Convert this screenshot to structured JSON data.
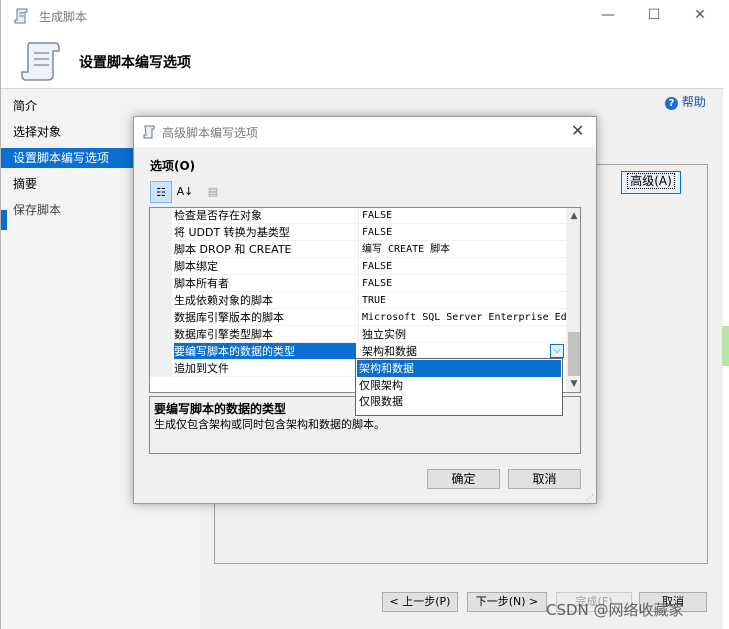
{
  "wizard": {
    "title": "生成脚本",
    "header_title": "设置脚本编写选项",
    "nav": [
      "简介",
      "选择对象",
      "设置脚本编写选项",
      "摘要",
      "保存脚本"
    ],
    "help": "帮助",
    "advanced_btn": "高级(A)",
    "buttons": {
      "prev": "< 上一步(P)",
      "next": "下一步(N) >",
      "finish": "完成(F)",
      "cancel": "取消"
    },
    "watermark": "CSDN @网络收藏家"
  },
  "dialog": {
    "title": "高级脚本编写选项",
    "options_label": "选项(O)",
    "rows": [
      {
        "name": "检查是否存在对象",
        "value": "FALSE"
      },
      {
        "name": "将 UDDT 转换为基类型",
        "value": "FALSE"
      },
      {
        "name": "脚本 DROP 和 CREATE",
        "value": "编写 CREATE 脚本"
      },
      {
        "name": "脚本绑定",
        "value": "FALSE"
      },
      {
        "name": "脚本所有者",
        "value": "FALSE"
      },
      {
        "name": "生成依赖对象的脚本",
        "value": "TRUE"
      },
      {
        "name": "数据库引擎版本的脚本",
        "value": "Microsoft SQL Server Enterprise Edition"
      },
      {
        "name": "数据库引擎类型脚本",
        "value": "独立实例"
      },
      {
        "name": "要编写脚本的数据的类型",
        "value": "架构和数据"
      },
      {
        "name": "追加到文件",
        "value": ""
      }
    ],
    "dropdown_options": [
      "架构和数据",
      "仅限架构",
      "仅限数据"
    ],
    "description_title": "要编写脚本的数据的类型",
    "description_text": "生成仅包含架构或同时包含架构和数据的脚本。",
    "ok": "确定",
    "cancel": "取消"
  }
}
